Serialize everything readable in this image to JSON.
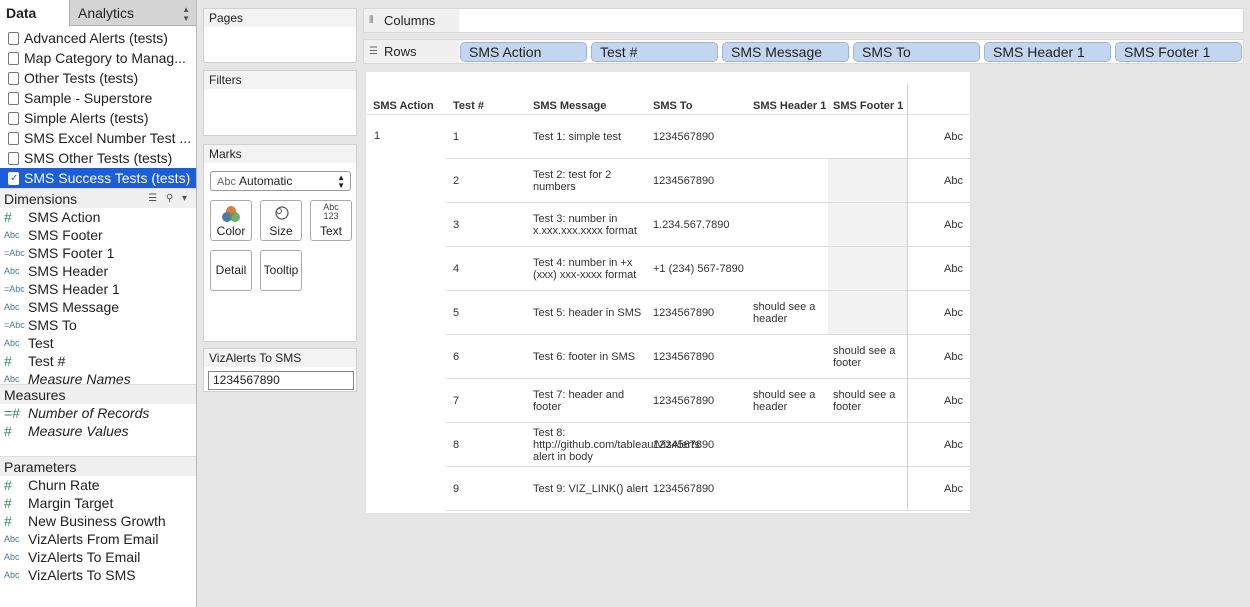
{
  "tabs": {
    "data": "Data",
    "analytics": "Analytics"
  },
  "datasources": [
    {
      "label": "Advanced Alerts (tests)",
      "selected": false
    },
    {
      "label": "Map Category to Manag...",
      "selected": false
    },
    {
      "label": "Other Tests (tests)",
      "selected": false
    },
    {
      "label": "Sample - Superstore",
      "selected": false
    },
    {
      "label": "Simple Alerts (tests)",
      "selected": false
    },
    {
      "label": "SMS Excel Number Test ...",
      "selected": false
    },
    {
      "label": "SMS Other Tests (tests)",
      "selected": false
    },
    {
      "label": "SMS Success Tests (tests)",
      "selected": true
    }
  ],
  "dimensions": {
    "title": "Dimensions",
    "items": [
      {
        "icon": "#",
        "label": "SMS Action",
        "italic": false
      },
      {
        "icon": "Abc",
        "label": "SMS Footer",
        "italic": false
      },
      {
        "icon": "=Abc",
        "label": "SMS Footer 1",
        "italic": false
      },
      {
        "icon": "Abc",
        "label": "SMS Header",
        "italic": false
      },
      {
        "icon": "=Abc",
        "label": "SMS Header 1",
        "italic": false
      },
      {
        "icon": "Abc",
        "label": "SMS Message",
        "italic": false
      },
      {
        "icon": "=Abc",
        "label": "SMS To",
        "italic": false
      },
      {
        "icon": "Abc",
        "label": "Test",
        "italic": false
      },
      {
        "icon": "#",
        "label": "Test #",
        "italic": false
      },
      {
        "icon": "Abc",
        "label": "Measure Names",
        "italic": true
      }
    ]
  },
  "measures": {
    "title": "Measures",
    "items": [
      {
        "icon": "=#",
        "label": "Number of Records",
        "italic": true
      },
      {
        "icon": "#",
        "label": "Measure Values",
        "italic": true
      }
    ]
  },
  "parameters": {
    "title": "Parameters",
    "items": [
      {
        "icon": "#",
        "label": "Churn Rate"
      },
      {
        "icon": "#",
        "label": "Margin Target"
      },
      {
        "icon": "#",
        "label": "New Business Growth"
      },
      {
        "icon": "Abc",
        "label": "VizAlerts From Email"
      },
      {
        "icon": "Abc",
        "label": "VizAlerts To Email"
      },
      {
        "icon": "Abc",
        "label": "VizAlerts To SMS"
      }
    ]
  },
  "cards": {
    "pages": "Pages",
    "filters": "Filters",
    "marks": "Marks",
    "mark_type_prefix": "Abc",
    "mark_type": "Automatic",
    "buttons": {
      "color": "Color",
      "size": "Size",
      "text": "Text",
      "detail": "Detail",
      "tooltip": "Tooltip"
    },
    "text_glyph_top": "Abc",
    "text_glyph_bottom": "123",
    "param_title": "VizAlerts To SMS",
    "param_value": "1234567890"
  },
  "shelves": {
    "columns_label": "Columns",
    "rows_label": "Rows",
    "row_pills": [
      "SMS Action",
      "Test #",
      "SMS Message",
      "SMS To",
      "SMS Header 1",
      "SMS Footer 1"
    ]
  },
  "table": {
    "headers": [
      "SMS Action",
      "Test #",
      "SMS Message",
      "SMS To",
      "SMS Header 1",
      "SMS Footer 1"
    ],
    "sms_action": "1",
    "rows": [
      {
        "test": "1",
        "message": "Test 1: simple test",
        "to": "1234567890",
        "header": "",
        "footer": "",
        "abc": "Abc"
      },
      {
        "test": "2",
        "message": "Test 2: test for 2 numbers",
        "to": "1234567890",
        "header": "",
        "footer": "",
        "abc": "Abc"
      },
      {
        "test": "3",
        "message": "Test 3: number in x.xxx.xxx.xxxx format",
        "to": "1.234.567.7890",
        "header": "",
        "footer": "",
        "abc": "Abc"
      },
      {
        "test": "4",
        "message": "Test 4: number in +x (xxx) xxx-xxxx format",
        "to": "+1 (234) 567-7890",
        "header": "",
        "footer": "",
        "abc": "Abc"
      },
      {
        "test": "5",
        "message": "Test 5: header in SMS",
        "to": "1234567890",
        "header": "should see a header",
        "footer": "",
        "abc": "Abc"
      },
      {
        "test": "6",
        "message": "Test 6: footer in SMS",
        "to": "1234567890",
        "header": "",
        "footer": "should see a footer",
        "abc": "Abc"
      },
      {
        "test": "7",
        "message": "Test 7: header and footer",
        "to": "1234567890",
        "header": "should see a header",
        "footer": "should see a footer",
        "abc": "Abc"
      },
      {
        "test": "8",
        "message": "Test 8: http://github.com/tableau/VizAlerts alert in body",
        "to": "1234567890",
        "header": "",
        "footer": "",
        "abc": "Abc"
      },
      {
        "test": "9",
        "message": "Test 9: VIZ_LINK() alert",
        "to": "1234567890",
        "header": "",
        "footer": "",
        "abc": "Abc"
      }
    ]
  }
}
